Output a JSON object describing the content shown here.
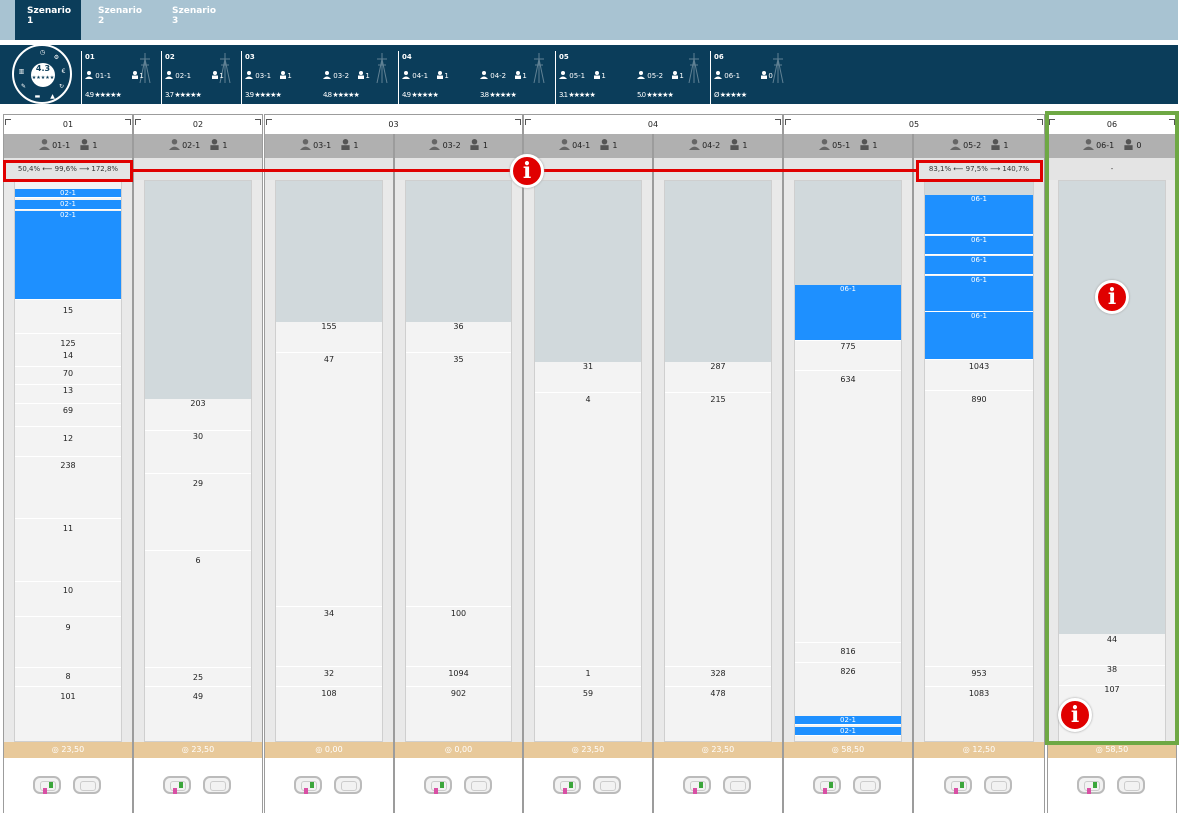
{
  "tabs": [
    {
      "label": "Szenario 1"
    },
    {
      "label": "Szenario 2"
    },
    {
      "label": "Szenario 3"
    }
  ],
  "dial": {
    "score": "4.3",
    "stars": "★★★★★"
  },
  "stations": [
    {
      "id": "01",
      "workers": [
        {
          "code": "01-1",
          "count": "1"
        }
      ],
      "ratings": [
        "4.9 ★★★★★"
      ]
    },
    {
      "id": "02",
      "workers": [
        {
          "code": "02-1",
          "count": "1"
        }
      ],
      "ratings": [
        "3.7 ★★★★★"
      ]
    },
    {
      "id": "03",
      "workers": [
        {
          "code": "03-1",
          "count": "1"
        },
        {
          "code": "03-2",
          "count": "1"
        }
      ],
      "ratings": [
        "3.9 ★★★★★",
        "4.8 ★★★★★"
      ]
    },
    {
      "id": "04",
      "workers": [
        {
          "code": "04-1",
          "count": "1"
        },
        {
          "code": "04-2",
          "count": "1"
        }
      ],
      "ratings": [
        "4.9 ★★★★★",
        "3.8 ★★★★★"
      ]
    },
    {
      "id": "05",
      "workers": [
        {
          "code": "05-1",
          "count": "1"
        },
        {
          "code": "05-2",
          "count": "1"
        }
      ],
      "ratings": [
        "3.1 ★★★★★",
        "5.0 ★★★★★"
      ]
    },
    {
      "id": "06",
      "workers": [
        {
          "code": "06-1",
          "count": "0"
        }
      ],
      "ratings": [
        "Ø ★★★★★"
      ]
    }
  ],
  "columns": [
    {
      "label": "01"
    },
    {
      "label": "02"
    },
    {
      "label": "03"
    },
    {
      "label": "04"
    },
    {
      "label": "05"
    },
    {
      "label": "06"
    }
  ],
  "lanes": [
    {
      "code": "01-1",
      "count": "1",
      "stats": "50,4% ⟵ 99,6% ⟶ 172,8%",
      "foot": "23,50",
      "blue_labels": [
        "02-1",
        "02-1",
        "02-1"
      ],
      "values": [
        "15",
        "125",
        "14",
        "70",
        "13",
        "69",
        "12",
        "238",
        "11",
        "10",
        "9",
        "8",
        "101"
      ]
    },
    {
      "code": "02-1",
      "count": "1",
      "stats": "",
      "foot": "23,50",
      "blue_labels": [],
      "values": [
        "203",
        "30",
        "29",
        "6",
        "25",
        "49"
      ]
    },
    {
      "code": "03-1",
      "count": "1",
      "stats": "",
      "foot": "0,00",
      "blue_labels": [],
      "values": [
        "155",
        "47",
        "34",
        "32",
        "108"
      ]
    },
    {
      "code": "03-2",
      "count": "1",
      "stats": "",
      "foot": "0,00",
      "blue_labels": [],
      "values": [
        "36",
        "35",
        "100",
        "1094",
        "902"
      ]
    },
    {
      "code": "04-1",
      "count": "1",
      "stats": "",
      "foot": "23,50",
      "blue_labels": [],
      "values": [
        "31",
        "4",
        "1",
        "59"
      ]
    },
    {
      "code": "04-2",
      "count": "1",
      "stats": "",
      "foot": "23,50",
      "blue_labels": [],
      "values": [
        "287",
        "215",
        "328",
        "478"
      ]
    },
    {
      "code": "05-1",
      "count": "1",
      "stats": "",
      "foot": "58,50",
      "blue_labels": [
        "06-1",
        "02-1",
        "02-1"
      ],
      "values": [
        "775",
        "634",
        "816",
        "826"
      ]
    },
    {
      "code": "05-2",
      "count": "1",
      "stats": "83,1% ⟵ 97,5% ⟶ 140,7%",
      "foot": "12,50",
      "blue_labels": [
        "06-1",
        "06-1",
        "06-1",
        "06-1",
        "06-1"
      ],
      "values": [
        "1043",
        "890",
        "953",
        "1083"
      ]
    },
    {
      "code": "06-1",
      "count": "0",
      "stats": "-",
      "foot": "58,50",
      "blue_labels": [],
      "values": [
        "44",
        "38",
        "107"
      ]
    }
  ],
  "info_marker": "i",
  "colors": {
    "navy": "#0b3d5a",
    "blue": "#1e90ff",
    "highlight_red": "#e00000",
    "highlight_green": "#6ea844",
    "footer": "#e8c99a"
  }
}
